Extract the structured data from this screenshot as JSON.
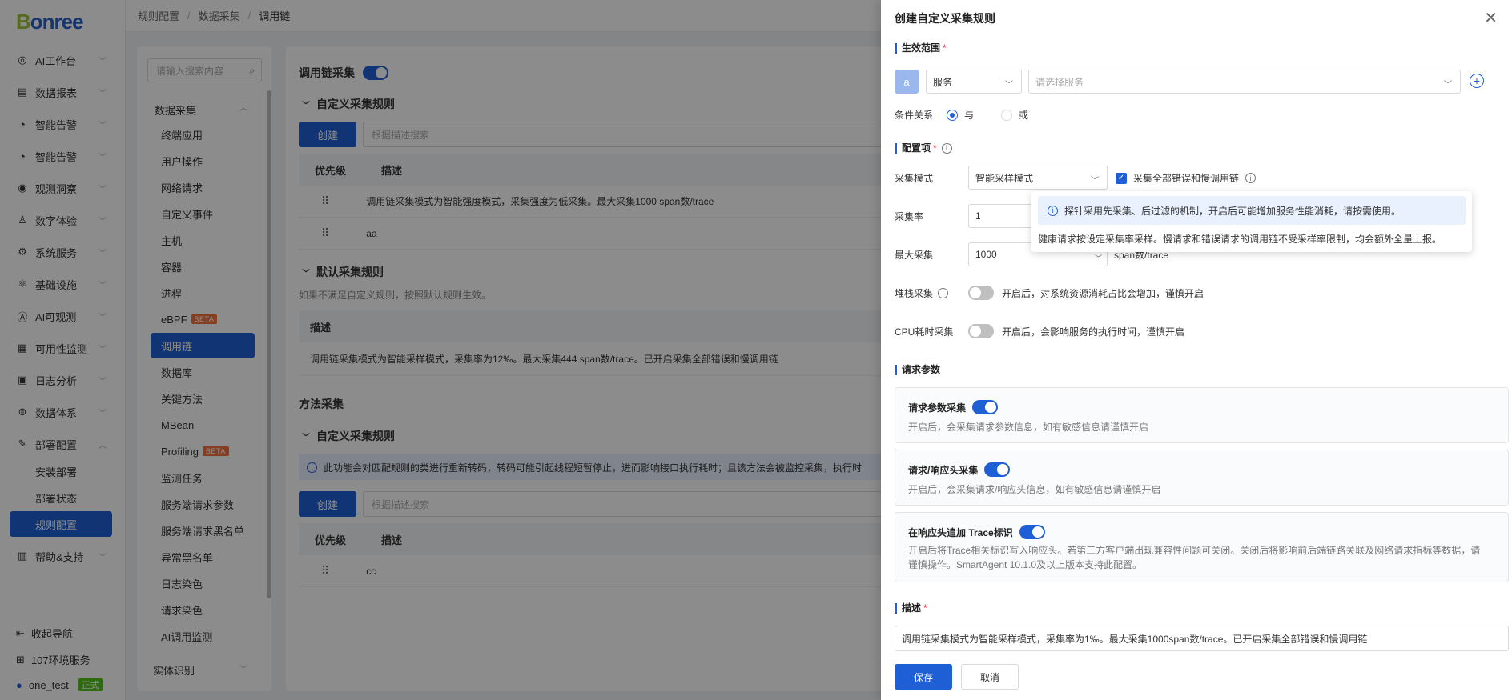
{
  "breadcrumb": {
    "items": [
      "规则配置",
      "数据采集",
      "调用链"
    ]
  },
  "sidebar": {
    "logo_b": "B",
    "logo_rest": "onree",
    "items": [
      {
        "label": "AI工作台",
        "icon": "robot-icon"
      },
      {
        "label": "数据报表",
        "icon": "report-icon"
      },
      {
        "label": "智能告警",
        "icon": "alarm-icon"
      },
      {
        "label": "智能告警",
        "icon": "alarm-icon"
      },
      {
        "label": "观测洞察",
        "icon": "insight-icon"
      },
      {
        "label": "数字体验",
        "icon": "experience-icon"
      },
      {
        "label": "系统服务",
        "icon": "system-icon"
      },
      {
        "label": "基础设施",
        "icon": "infra-icon"
      },
      {
        "label": "AI可观测",
        "icon": "ai-icon"
      },
      {
        "label": "可用性监测",
        "icon": "monitor-icon"
      },
      {
        "label": "日志分析",
        "icon": "log-icon"
      },
      {
        "label": "数据体系",
        "icon": "data-icon"
      },
      {
        "label": "部署配置",
        "icon": "deploy-icon"
      }
    ],
    "sub_items": [
      "安装部署",
      "部署状态",
      "规则配置"
    ],
    "help": "帮助&支持",
    "collapse": "收起导航",
    "env": "107环境服务",
    "user": "one_test",
    "user_tag": "正式"
  },
  "subnav": {
    "search_placeholder": "请输入搜索内容",
    "group": "数据采集",
    "items": [
      "终端应用",
      "用户操作",
      "网络请求",
      "自定义事件",
      "主机",
      "容器",
      "进程",
      "eBPF",
      "调用链",
      "数据库",
      "关键方法",
      "MBean",
      "Profiling",
      "监测任务",
      "服务端请求参数",
      "服务端请求黑名单",
      "异常黑名单",
      "日志染色",
      "请求染色",
      "AI调用监测"
    ],
    "beta": "BETA",
    "group2": "实体识别"
  },
  "main": {
    "title": "调用链采集",
    "custom_rules": "自定义采集规则",
    "create": "创建",
    "desc_search": "根据描述搜索",
    "col_priority": "优先级",
    "col_desc": "描述",
    "rows": [
      "调用链采集模式为智能强度模式，采集强度为低采集。最大采集1000 span数/trace",
      "aa"
    ],
    "default_rules": "默认采集规则",
    "default_hint": "如果不满足自定义规则，按照默认规则生效。",
    "default_desc_col": "描述",
    "default_row": "调用链采集模式为智能采样模式，采集率为12‰。最大采集444 span数/trace。已开启采集全部错误和慢调用链",
    "method_title": "方法采集",
    "method_custom": "自定义采集规则",
    "method_notice": "此功能会对匹配规则的类进行重新转码，转码可能引起线程短暂停止，进而影响接口执行耗时；且该方法会被监控采集，执行时",
    "method_rows": [
      "cc"
    ]
  },
  "drawer": {
    "title": "创建自定义采集规则",
    "scope": "生效范围",
    "scope_a": "a",
    "scope_type": "服务",
    "scope_placeholder": "请选择服务",
    "cond_label": "条件关系",
    "cond_and": "与",
    "cond_or": "或",
    "config": "配置项",
    "mode_label": "采集模式",
    "mode_value": "智能采样模式",
    "all_errors": "采集全部错误和慢调用链",
    "rate_label": "采集率",
    "rate_value": "1",
    "max_label": "最大采集",
    "max_value": "1000",
    "max_unit": "span数/trace",
    "stack_label": "堆栈采集",
    "stack_desc": "开启后，对系统资源消耗占比会增加，谨慎开启",
    "cpu_label": "CPU耗时采集",
    "cpu_desc": "开启后，会影响服务的执行时间，谨慎开启",
    "req_params": "请求参数",
    "card1_title": "请求参数采集",
    "card1_desc": "开启后，会采集请求参数信息，如有敏感信息请谨慎开启",
    "card2_title": "请求/响应头采集",
    "card2_desc": "开启后，会采集请求/响应头信息，如有敏感信息请谨慎开启",
    "card3_title": "在响应头追加 Trace标识",
    "card3_desc": "开启后将Trace相关标识写入响应头。若第三方客户端出现兼容性问题可关闭。关闭后将影响前后端链路关联及网络请求指标等数据，请谨慎操作。SmartAgent 10.1.0及以上版本支持此配置。",
    "desc_label": "描述",
    "desc_value": "调用链采集模式为智能采样模式，采集率为1‰。最大采集1000span数/trace。已开启采集全部错误和慢调用链",
    "save": "保存",
    "cancel": "取消"
  },
  "popover": {
    "line1": "探针采用先采集、后过滤的机制，开启后可能增加服务性能消耗，请按需使用。",
    "line2": "健康请求按设定采集率采样。慢请求和错误请求的调用链不受采样率限制，均会额外全量上报。"
  }
}
